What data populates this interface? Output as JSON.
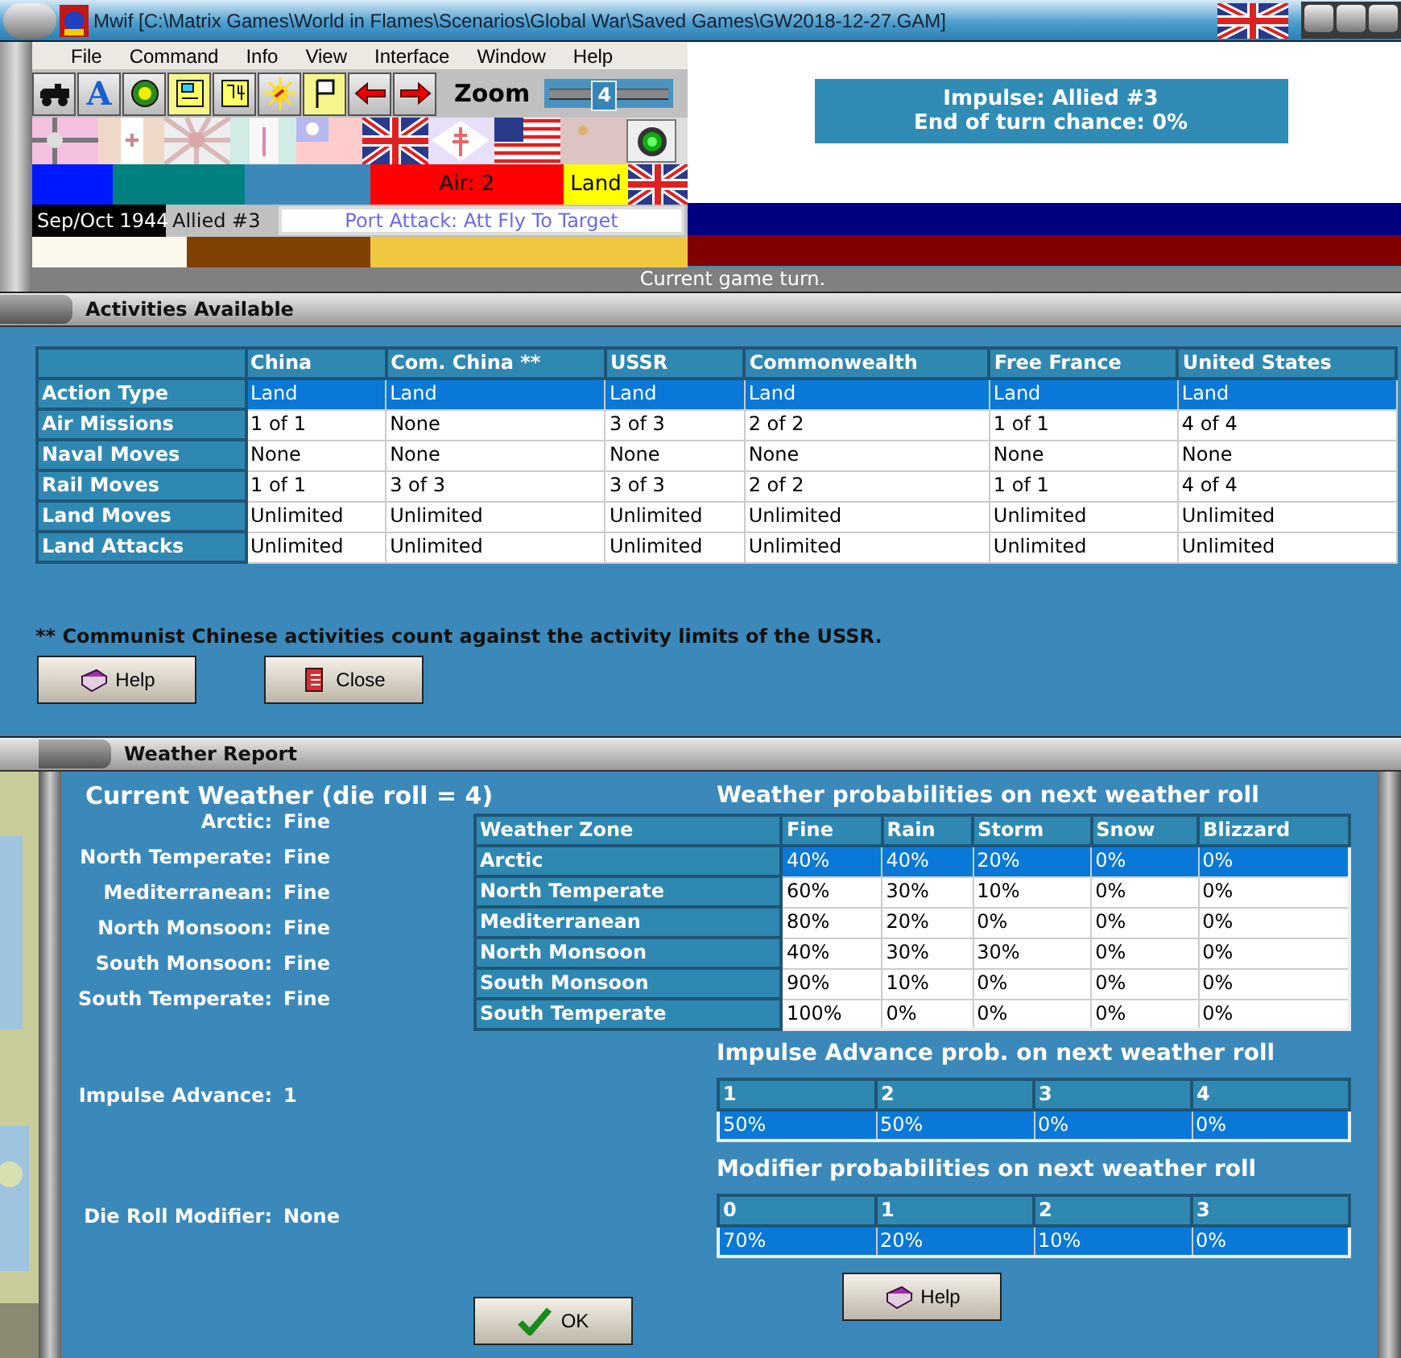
{
  "window": {
    "title": "Mwif [C:\\Matrix Games\\World in Flames\\Scenarios\\Global War\\Saved Games\\GW2018-12-27.GAM]"
  },
  "menu": [
    "File",
    "Command",
    "Info",
    "View",
    "Interface",
    "Window",
    "Help"
  ],
  "toolbar": {
    "letter_tool": "A",
    "zoom_label": "Zoom",
    "zoom_value": "4",
    "zoom": {
      "level": 0.45
    }
  },
  "strip": {
    "air": "Air: 2",
    "action": "Land",
    "date": "Sep/Oct 1944",
    "impulse": "Allied #3",
    "port_attack": "Port Attack: Att Fly To Target"
  },
  "impulse_box": [
    "Impulse: Allied #3",
    "End of turn chance: 0%"
  ],
  "status_text": "Current game turn.",
  "activities": {
    "title": "Activities Available",
    "columns": [
      "China",
      "Com. China **",
      "USSR",
      "Commonwealth",
      "Free France",
      "United States"
    ],
    "rows": [
      {
        "label": "Action Type",
        "cells": [
          "Land",
          "Land",
          "Land",
          "Land",
          "Land",
          "Land"
        ],
        "selected": true
      },
      {
        "label": "Air Missions",
        "cells": [
          "1 of 1",
          "None",
          "3 of 3",
          "2 of 2",
          "1 of 1",
          "4 of 4"
        ],
        "selected": false
      },
      {
        "label": "Naval Moves",
        "cells": [
          "None",
          "None",
          "None",
          "None",
          "None",
          "None"
        ],
        "selected": false
      },
      {
        "label": "Rail Moves",
        "cells": [
          "1 of 1",
          "3 of 3",
          "3 of 3",
          "2 of 2",
          "1 of 1",
          "4 of 4"
        ],
        "selected": false
      },
      {
        "label": "Land Moves",
        "cells": [
          "Unlimited",
          "Unlimited",
          "Unlimited",
          "Unlimited",
          "Unlimited",
          "Unlimited"
        ],
        "selected": false
      },
      {
        "label": "Land Attacks",
        "cells": [
          "Unlimited",
          "Unlimited",
          "Unlimited",
          "Unlimited",
          "Unlimited",
          "Unlimited"
        ],
        "selected": false
      }
    ],
    "footnote": "** Communist Chinese activities count against the activity limits of the USSR.",
    "buttons": [
      {
        "label": "Help",
        "kind": "help"
      },
      {
        "label": "Close",
        "kind": "close"
      }
    ]
  },
  "weather": {
    "title": "Weather Report",
    "current_heading": "Current Weather (die roll = 4)",
    "zones": [
      {
        "label": "Arctic:",
        "value": "Fine"
      },
      {
        "label": "North Temperate:",
        "value": "Fine"
      },
      {
        "label": "Mediterranean:",
        "value": "Fine"
      },
      {
        "label": "North Monsoon:",
        "value": "Fine"
      },
      {
        "label": "South Monsoon:",
        "value": "Fine"
      },
      {
        "label": "South Temperate:",
        "value": "Fine"
      }
    ],
    "impulse_advance": {
      "label": "Impulse Advance:",
      "value": "1"
    },
    "die_roll_modifier": {
      "label": "Die Roll Modifier:",
      "value": "None"
    },
    "probabilities": {
      "heading": "Weather probabilities on next weather roll",
      "columns": [
        "Weather Zone",
        "Fine",
        "Rain",
        "Storm",
        "Snow",
        "Blizzard"
      ],
      "rows": [
        {
          "cells": [
            "Arctic",
            "40%",
            "40%",
            "20%",
            "0%",
            "0%"
          ],
          "selected": true
        },
        {
          "cells": [
            "North Temperate",
            "60%",
            "30%",
            "10%",
            "0%",
            "0%"
          ],
          "selected": false
        },
        {
          "cells": [
            "Mediterranean",
            "80%",
            "20%",
            "0%",
            "0%",
            "0%"
          ],
          "selected": false
        },
        {
          "cells": [
            "North Monsoon",
            "40%",
            "30%",
            "30%",
            "0%",
            "0%"
          ],
          "selected": false
        },
        {
          "cells": [
            "South Monsoon",
            "90%",
            "10%",
            "0%",
            "0%",
            "0%"
          ],
          "selected": false
        },
        {
          "cells": [
            "South Temperate",
            "100%",
            "0%",
            "0%",
            "0%",
            "0%"
          ],
          "selected": false
        }
      ]
    },
    "impulse_prob": {
      "heading": "Impulse Advance prob. on next weather roll",
      "columns": [
        "1",
        "2",
        "3",
        "4"
      ],
      "rows": [
        {
          "cells": [
            "50%",
            "50%",
            "0%",
            "0%"
          ],
          "selected": true
        }
      ]
    },
    "modifier_prob": {
      "heading": "Modifier probabilities on next weather roll",
      "columns": [
        "0",
        "1",
        "2",
        "3"
      ],
      "rows": [
        {
          "cells": [
            "70%",
            "20%",
            "10%",
            "0%"
          ],
          "selected": true
        }
      ]
    },
    "buttons": [
      {
        "label": "OK",
        "kind": "ok"
      },
      {
        "label": "Help",
        "kind": "help"
      }
    ]
  }
}
